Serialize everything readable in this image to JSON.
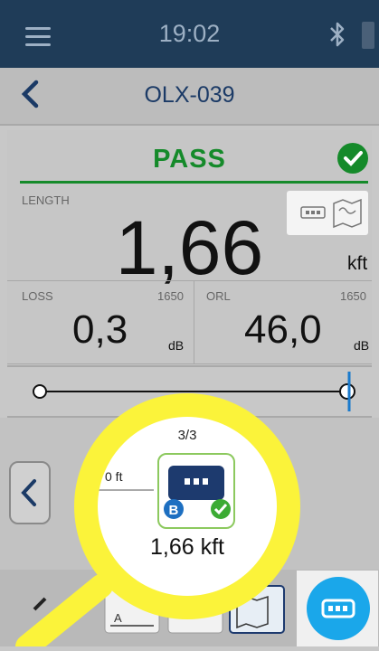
{
  "status": {
    "time": "19:02"
  },
  "header": {
    "title": "OLX-039"
  },
  "result": {
    "verdict": "PASS"
  },
  "length": {
    "label": "LENGTH",
    "value": "1,66",
    "unit": "kft"
  },
  "loss": {
    "label": "LOSS",
    "wavelength": "1650",
    "value": "0,3",
    "unit": "dB"
  },
  "orl": {
    "label": "ORL",
    "wavelength": "1650",
    "value": "46,0",
    "unit": "dB"
  },
  "magnifier": {
    "page": "3/3",
    "distance": "0 ft",
    "element_value": "1,66 kft",
    "badge": "B"
  },
  "colors": {
    "status_bar": "#1f3c58",
    "pass": "#158a2a",
    "accent_blue": "#1aa7ea",
    "highlight": "#fbf33a"
  },
  "icons": [
    "menu-icon",
    "bluetooth-icon",
    "battery-icon",
    "back-arrow-icon",
    "check-icon",
    "connector-icon",
    "map-icon",
    "chevron-left-icon",
    "device-icon",
    "ruler-icon",
    "fab-device-icon"
  ]
}
